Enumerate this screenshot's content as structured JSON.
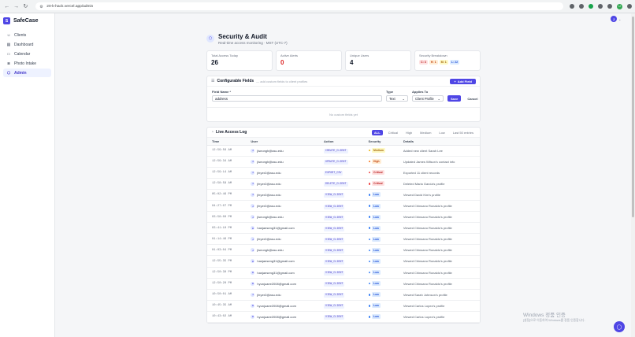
{
  "browser": {
    "url": "20-k-hack.vercel.app/admin",
    "profile_initial": "U"
  },
  "sidebar": {
    "brand_initial": "S",
    "brand_name": "SafeCase",
    "items": [
      {
        "label": "Clients",
        "icon": "users-icon",
        "glyph": "☺",
        "active": false
      },
      {
        "label": "Dashboard",
        "icon": "grid-icon",
        "glyph": "▦",
        "active": false
      },
      {
        "label": "Calendar",
        "icon": "calendar-icon",
        "glyph": "▭",
        "active": false
      },
      {
        "label": "Photo Intake",
        "icon": "camera-icon",
        "glyph": "◙",
        "active": false
      },
      {
        "label": "Admin",
        "icon": "shield-icon",
        "glyph": "⬡",
        "active": true
      }
    ]
  },
  "user": {
    "initial": "J"
  },
  "header": {
    "title": "Security & Audit",
    "subtitle": "Real-time access monitoring · MST (UTC-7)"
  },
  "stats": [
    {
      "label": "Total Access Today",
      "value": "26"
    },
    {
      "label": "Active Alerts",
      "value": "0"
    },
    {
      "label": "Unique Users",
      "value": "4"
    },
    {
      "label": "Security Breakdown",
      "chips": [
        "C: 3",
        "H: 1",
        "M: 1",
        "L: 22"
      ]
    }
  ],
  "fields": {
    "title": "Configurable Fields",
    "hint": "— add custom fields to client profiles",
    "add_label": "Add Field",
    "name_label": "Field Name *",
    "name_value": "address",
    "type_label": "Type",
    "type_value": "Text",
    "applies_label": "Applies To",
    "applies_value": "Client Profile",
    "save_label": "Save",
    "cancel_label": "Cancel",
    "empty_text": "No custom fields yet"
  },
  "log": {
    "title": "Live Access Log",
    "filters": [
      "ALL",
      "Critical",
      "High",
      "Medium",
      "Low",
      "Last 50 entries"
    ],
    "columns": [
      "Time",
      "User",
      "Action",
      "Security",
      "Details"
    ],
    "rows": [
      {
        "time": "12:59:56 AM",
        "user": "jlseongh@asu.edu",
        "action": "CREATE_CLIENT",
        "security": "Medium",
        "details": "Added new client Sarah Lee"
      },
      {
        "time": "12:59:34 AM",
        "user": "jlseongh@asu.edu",
        "action": "UPDATE_CLIENT",
        "security": "High",
        "details": "Updated James Wilson's contact info"
      },
      {
        "time": "12:59:14 AM",
        "user": "jfeyer2@asu.edu",
        "action": "EXPORT_CSV",
        "security": "Critical",
        "details": "Exported 11 client records"
      },
      {
        "time": "12:58:58 AM",
        "user": "jfeyer2@asu.edu",
        "action": "DELETE_CLIENT",
        "security": "Critical",
        "details": "Deleted Maria Garcia's profile"
      },
      {
        "time": "05:02:46 PM",
        "user": "jfeyer2@asu.edu",
        "action": "VIEW_CLIENT",
        "security": "Low",
        "details": "Viewed David Kim's profile"
      },
      {
        "time": "04:27:07 PM",
        "user": "jfeyer2@asu.edu",
        "action": "VIEW_CLIENT",
        "security": "Low",
        "details": "Viewed Chinsano Ronaldo's profile"
      },
      {
        "time": "03:58:00 PM",
        "user": "jlseongh@asu.edu",
        "action": "VIEW_CLIENT",
        "security": "Low",
        "details": "Viewed Chinsano Ronaldo's profile"
      },
      {
        "time": "03:41:10 PM",
        "user": "hanjaeseng31@gmail.com",
        "action": "VIEW_CLIENT",
        "security": "Low",
        "details": "Viewed Chinsano Ronaldo's profile"
      },
      {
        "time": "01:14:46 PM",
        "user": "jfeyer2@asu.edu",
        "action": "VIEW_CLIENT",
        "security": "Low",
        "details": "Viewed Chinsano Ronaldo's profile"
      },
      {
        "time": "01:03:04 PM",
        "user": "jlseongh@asu.edu",
        "action": "VIEW_CLIENT",
        "security": "Low",
        "details": "Viewed Chinsano Ronaldo's profile"
      },
      {
        "time": "12:55:35 PM",
        "user": "hanjaeseng31@gmail.com",
        "action": "VIEW_CLIENT",
        "security": "Low",
        "details": "Viewed Chinsano Ronaldo's profile"
      },
      {
        "time": "12:50:30 PM",
        "user": "hanjaeseng31@gmail.com",
        "action": "VIEW_CLIENT",
        "security": "Low",
        "details": "Viewed Chinsano Ronaldo's profile"
      },
      {
        "time": "12:50:20 PM",
        "user": "hyunjuaee2008@gmail.com",
        "action": "VIEW_CLIENT",
        "security": "Low",
        "details": "Viewed Chinsano Ronaldo's profile"
      },
      {
        "time": "10:50:01 AM",
        "user": "jfeyer2@asu.edu",
        "action": "VIEW_CLIENT",
        "security": "Low",
        "details": "Viewed Sarah Johnson's profile"
      },
      {
        "time": "10:45:35 AM",
        "user": "hyunjuaee2008@gmail.com",
        "action": "VIEW_CLIENT",
        "security": "Low",
        "details": "Viewed Carlos Lopez's profile"
      },
      {
        "time": "10:43:02 AM",
        "user": "hyunjuaee2008@gmail.com",
        "action": "VIEW_CLIENT",
        "security": "Low",
        "details": "Viewed Carlos Lopez's profile"
      }
    ]
  },
  "watermark": {
    "title": "Windows 정품 인증",
    "subtitle": "[설정]으로 이동하여 Windows를 정품 인증합니다."
  },
  "colors": {
    "accent": "#4f46e5",
    "critical": "#ef4444",
    "high": "#f97316",
    "medium": "#eab308",
    "low": "#3b82f6"
  }
}
